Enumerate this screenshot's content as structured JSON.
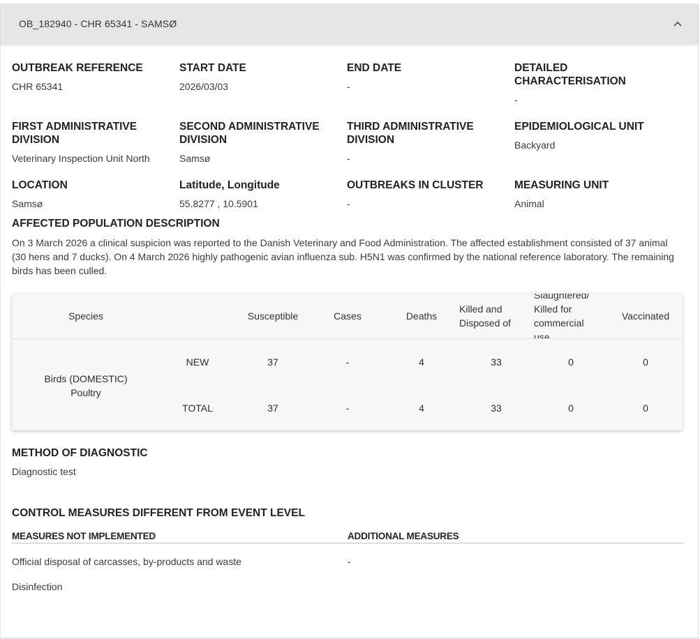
{
  "header": {
    "title": "OB_182940 - CHR 65341 - SAMSØ"
  },
  "fields": {
    "outbreak_reference": {
      "label": "OUTBREAK REFERENCE",
      "value": "CHR 65341"
    },
    "start_date": {
      "label": "START DATE",
      "value": "2026/03/03"
    },
    "end_date": {
      "label": "END DATE",
      "value": "-"
    },
    "detailed_characterisation": {
      "label": "DETAILED CHARACTERISATION",
      "value": "-"
    },
    "first_admin": {
      "label": "FIRST ADMINISTRATIVE DIVISION",
      "value": "Veterinary Inspection Unit North"
    },
    "second_admin": {
      "label": "SECOND ADMINISTRATIVE DIVISION",
      "value": "Samsø"
    },
    "third_admin": {
      "label": "THIRD ADMINISTRATIVE DIVISION",
      "value": "-"
    },
    "epi_unit": {
      "label": "EPIDEMIOLOGICAL UNIT",
      "value": "Backyard"
    },
    "location": {
      "label": "LOCATION",
      "value": "Samsø"
    },
    "lat_long": {
      "label": "Latitude, Longitude",
      "value": "55.8277 , 10.5901"
    },
    "outbreaks_in_cluster": {
      "label": "OUTBREAKS IN CLUSTER",
      "value": "-"
    },
    "measuring_unit": {
      "label": "MEASURING UNIT",
      "value": "Animal"
    }
  },
  "affected_population": {
    "label": "AFFECTED POPULATION DESCRIPTION",
    "text": "On 3 March 2026 a clinical suspicion was reported to the Danish Veterinary and Food Administration. The affected establishment consisted of 37 animal (30 hens and 7 ducks). On 4 March 2026 highly pathogenic avian influenza sub. H5N1 was confirmed by the national reference laboratory. The remaining birds has been culled."
  },
  "table": {
    "headers": {
      "species": "Species",
      "susceptible": "Susceptible",
      "cases": "Cases",
      "deaths": "Deaths",
      "killed_disposed": "Killed and Disposed of",
      "slaughtered": "Slaughtered/ Killed for commercial use",
      "vaccinated": "Vaccinated"
    },
    "species_name": "Birds (DOMESTIC) Poultry",
    "rows": [
      {
        "label": "NEW",
        "susceptible": "37",
        "cases": "-",
        "deaths": "4",
        "killed": "33",
        "slaughtered": "0",
        "vaccinated": "0"
      },
      {
        "label": "TOTAL",
        "susceptible": "37",
        "cases": "-",
        "deaths": "4",
        "killed": "33",
        "slaughtered": "0",
        "vaccinated": "0"
      }
    ]
  },
  "diagnostic": {
    "label": "METHOD OF DIAGNOSTIC",
    "value": "Diagnostic test"
  },
  "control_measures": {
    "label": "CONTROL MEASURES DIFFERENT FROM EVENT LEVEL",
    "not_implemented_label": "MEASURES NOT IMPLEMENTED",
    "additional_label": "ADDITIONAL MEASURES",
    "not_implemented": [
      "Official disposal of carcasses, by-products and waste",
      "Disinfection"
    ],
    "additional": [
      "-"
    ]
  }
}
